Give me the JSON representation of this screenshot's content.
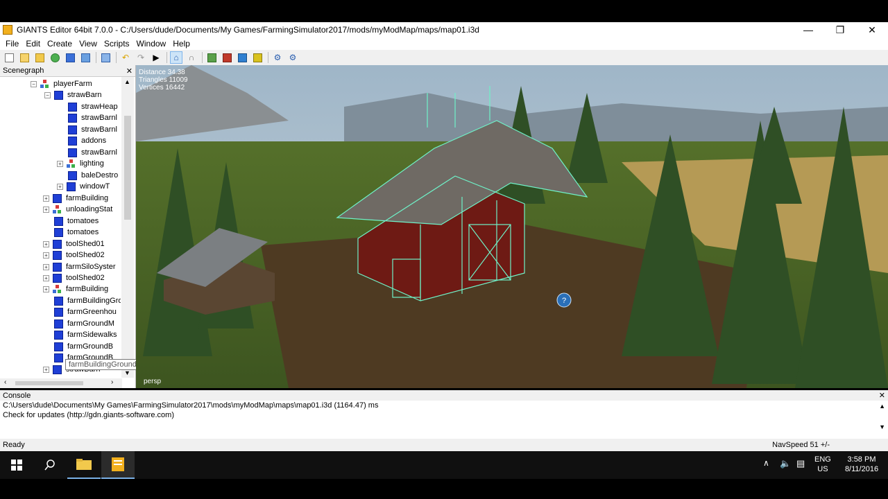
{
  "window": {
    "title": "GIANTS Editor 64bit 7.0.0 - C:/Users/dude/Documents/My Games/FarmingSimulator2017/mods/myModMap/maps/map01.i3d"
  },
  "window_controls": {
    "minimize": "—",
    "restore": "❐",
    "close": "✕"
  },
  "menu": [
    "File",
    "Edit",
    "Create",
    "View",
    "Scripts",
    "Window",
    "Help"
  ],
  "scenegraph": {
    "title": "Scenegraph",
    "close": "✕",
    "items": [
      {
        "label": "playerFarm"
      },
      {
        "label": "strawBarn"
      },
      {
        "label": "strawHeap"
      },
      {
        "label": "strawBarnl"
      },
      {
        "label": "strawBarnl"
      },
      {
        "label": "addons"
      },
      {
        "label": "strawBarnl"
      },
      {
        "label": "lighting"
      },
      {
        "label": "baleDestro"
      },
      {
        "label": "windowT"
      },
      {
        "label": "farmBuilding"
      },
      {
        "label": "unloadingStat"
      },
      {
        "label": "tomatoes"
      },
      {
        "label": "tomatoes"
      },
      {
        "label": "toolShed01"
      },
      {
        "label": "toolShed02"
      },
      {
        "label": "farmSiloSyster"
      },
      {
        "label": "toolShed02"
      },
      {
        "label": "farmBuilding"
      },
      {
        "label": "farmBuildingGround"
      },
      {
        "label": "farmGreenhou"
      },
      {
        "label": "farmGroundM"
      },
      {
        "label": "farmSidewalks"
      },
      {
        "label": "farmGroundB"
      },
      {
        "label": "farmGroundB"
      },
      {
        "label": "strawBarn"
      }
    ],
    "tooltip": "farmBuildingGround"
  },
  "viewport": {
    "distance": "Distance 34.38",
    "triangles": "Triangles 11009",
    "vertices": "Vertices 16442",
    "camera": "persp"
  },
  "console": {
    "title": "Console",
    "close": "✕",
    "lines": [
      "C:\\Users\\dude\\Documents\\My Games\\FarmingSimulator2017\\mods\\myModMap\\maps\\map01.i3d (1164.47) ms",
      "Check for updates (http://gdn.giants-software.com)"
    ]
  },
  "status": {
    "left": "Ready",
    "right": "NavSpeed 51 +/-"
  },
  "taskbar": {
    "lang": "ENG",
    "region": "US",
    "time": "3:58 PM",
    "date": "8/11/2016"
  }
}
